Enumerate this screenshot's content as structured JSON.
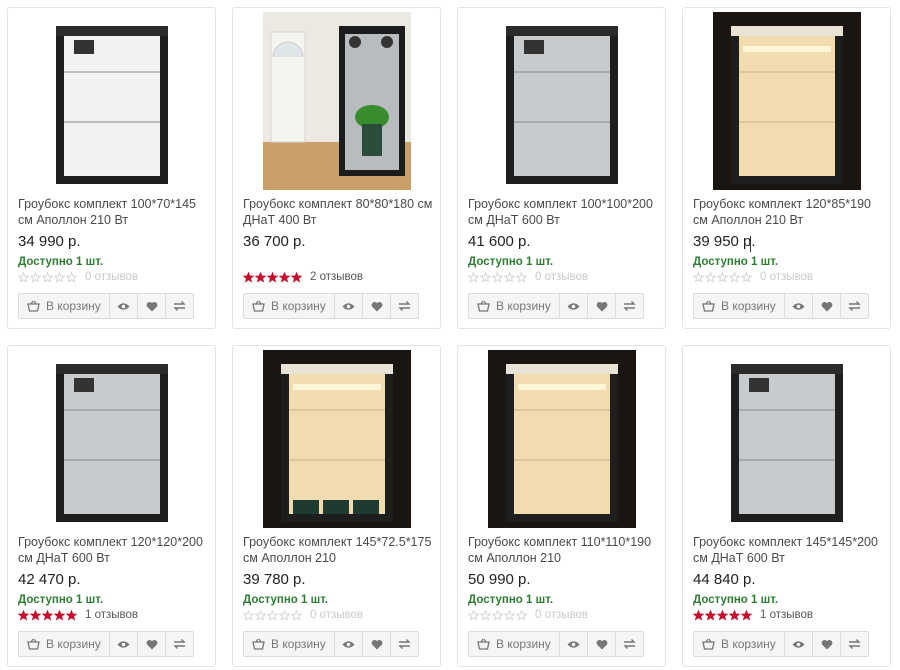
{
  "products": [
    {
      "title": "Гроубокс комплект 100*70*145 см Аполлон 210 Вт",
      "price": "34 990 р.",
      "stock": "Доступно 1 шт.",
      "rating": 0,
      "reviews": "0 отзывов",
      "photo": "white-grow-tent"
    },
    {
      "title": "Гроубокс комплект 80*80*180 см ДНаТ 400 Вт",
      "price": "36 700 р.",
      "stock": "",
      "rating": 5,
      "reviews": "2 отзывов",
      "photo": "grow-tent-room"
    },
    {
      "title": "Гроубокс комплект 100*100*200 см ДНаТ 600 Вт",
      "price": "41 600 р.",
      "stock": "Доступно 1 шт.",
      "rating": 0,
      "reviews": "0 отзывов",
      "photo": "silver-grow-tent"
    },
    {
      "title": "Гроубокс комплект 120*85*190 см Аполлон 210 Вт",
      "price": "39 950 р.",
      "stock": "Доступно 1 шт.",
      "rating": 0,
      "reviews": "0 отзывов",
      "photo": "lit-grow-tent"
    },
    {
      "title": "Гроубокс комплект 120*120*200 см ДНаТ 600 Вт",
      "price": "42 470 р.",
      "stock": "Доступно 1 шт.",
      "rating": 5,
      "reviews": "1 отзывов",
      "photo": "silver-grow-tent"
    },
    {
      "title": "Гроубокс комплект 145*72.5*175 см Аполлон 210",
      "price": "39 780 р.",
      "stock": "Доступно 1 шт.",
      "rating": 0,
      "reviews": "0 отзывов",
      "photo": "lit-grow-tent-pots"
    },
    {
      "title": "Гроубокс комплект 110*110*190 см Аполлон 210",
      "price": "50 990 р.",
      "stock": "Доступно 1 шт.",
      "rating": 0,
      "reviews": "0 отзывов",
      "photo": "lit-grow-tent"
    },
    {
      "title": "Гроубокс комплект 145*145*200 см ДНаТ 600 Вт",
      "price": "44 840 р.",
      "stock": "Доступно 1 шт.",
      "rating": 5,
      "reviews": "1 отзывов",
      "photo": "silver-grow-tent"
    }
  ],
  "labels": {
    "cart": "В корзину"
  },
  "icons": {
    "cart": "basket-icon",
    "view": "eye-icon",
    "wishlist": "heart-icon",
    "compare": "compare-arrows-icon"
  },
  "colors": {
    "stock": "#2e7d32",
    "star_filled": "#c8102e",
    "star_empty": "#cfcfcf"
  }
}
